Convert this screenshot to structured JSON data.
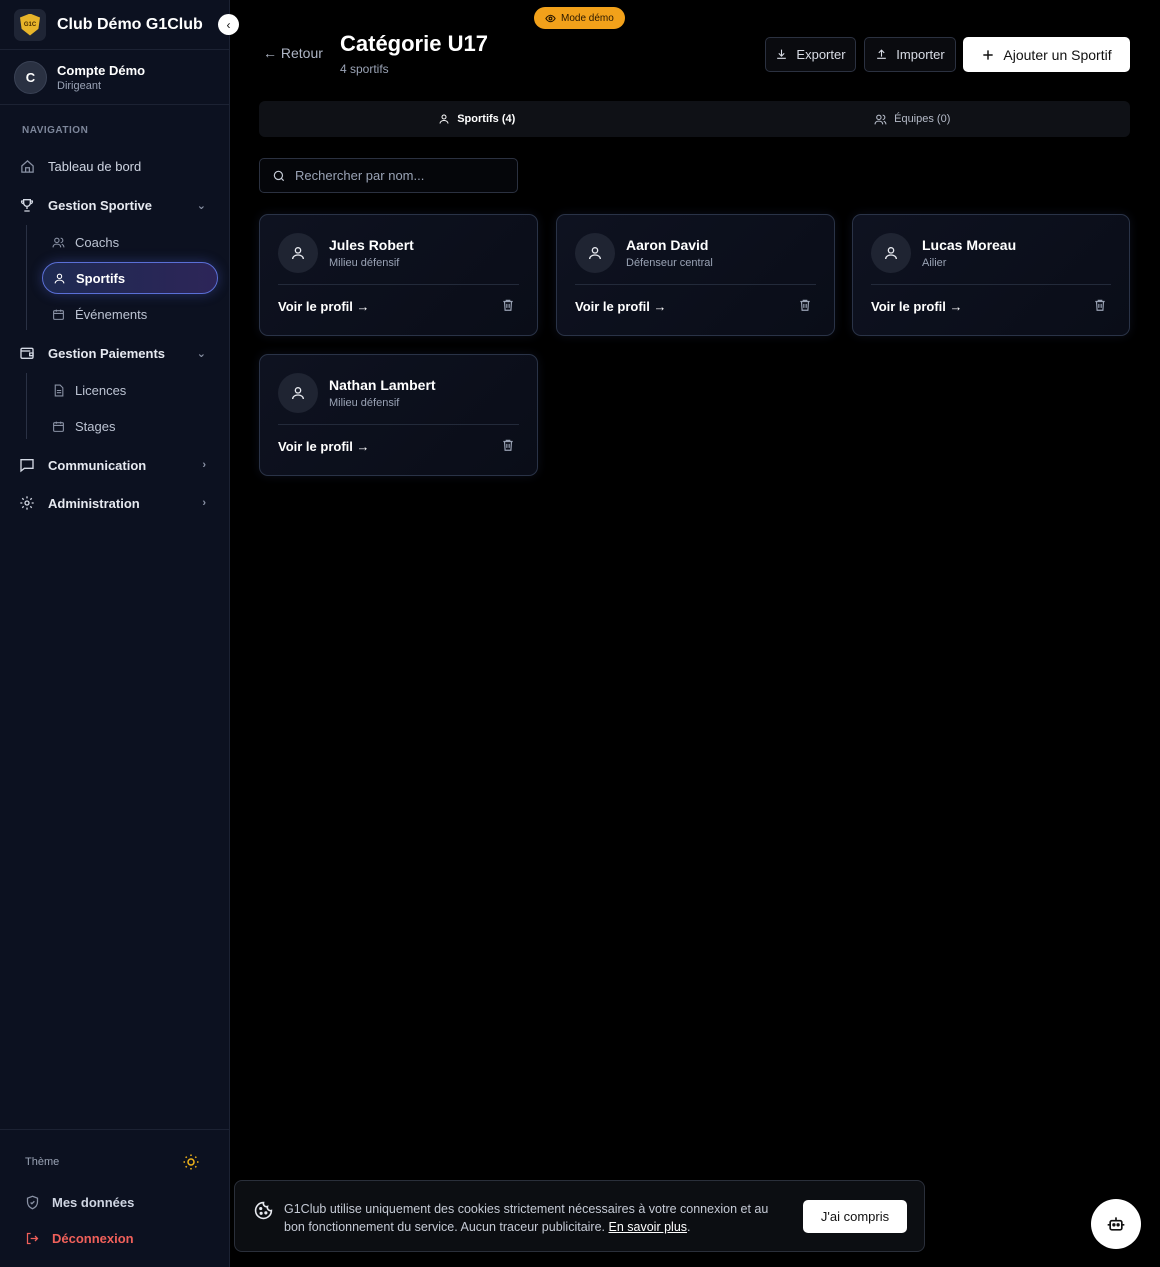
{
  "app": {
    "name": "Club Démo G1Club",
    "logo_text": "G1C"
  },
  "account": {
    "initial": "C",
    "name": "Compte Démo",
    "role": "Dirigeant"
  },
  "nav": {
    "title": "NAVIGATION",
    "dashboard": "Tableau de bord",
    "sport_mgmt": "Gestion Sportive",
    "coaches": "Coachs",
    "athletes": "Sportifs",
    "events": "Événements",
    "payments": "Gestion Paiements",
    "licences": "Licences",
    "camps": "Stages",
    "communication": "Communication",
    "administration": "Administration"
  },
  "sidebar_bottom": {
    "theme": "Thème",
    "my_data": "Mes données",
    "logout": "Déconnexion"
  },
  "header": {
    "demo_badge": "Mode démo",
    "back": "← Retour",
    "title": "Catégorie U17",
    "subtitle": "4 sportifs",
    "export": "Exporter",
    "import": "Importer",
    "add": "Ajouter un Sportif"
  },
  "tabs": {
    "athletes": "Sportifs (4)",
    "teams": "Équipes (0)"
  },
  "search": {
    "placeholder": "Rechercher par nom..."
  },
  "players": [
    {
      "name": "Jules Robert",
      "position": "Milieu défensif",
      "link": "Voir le profil →"
    },
    {
      "name": "Aaron David",
      "position": "Défenseur central",
      "link": "Voir le profil →"
    },
    {
      "name": "Lucas Moreau",
      "position": "Ailier",
      "link": "Voir le profil →"
    },
    {
      "name": "Nathan Lambert",
      "position": "Milieu défensif",
      "link": "Voir le profil →"
    }
  ],
  "cookie": {
    "text": "G1Club utilise uniquement des cookies strictement nécessaires à votre connexion et au bon fonctionnement du service. Aucun traceur publicitaire.",
    "link": "En savoir plus",
    "button": "J'ai compris"
  },
  "colors": {
    "sidebar_bg": "#0c1120",
    "accent": "#5a6fd6",
    "demo_badge": "#f2a11a",
    "logout": "#f0605a",
    "theme_icon": "#f2b51a"
  }
}
